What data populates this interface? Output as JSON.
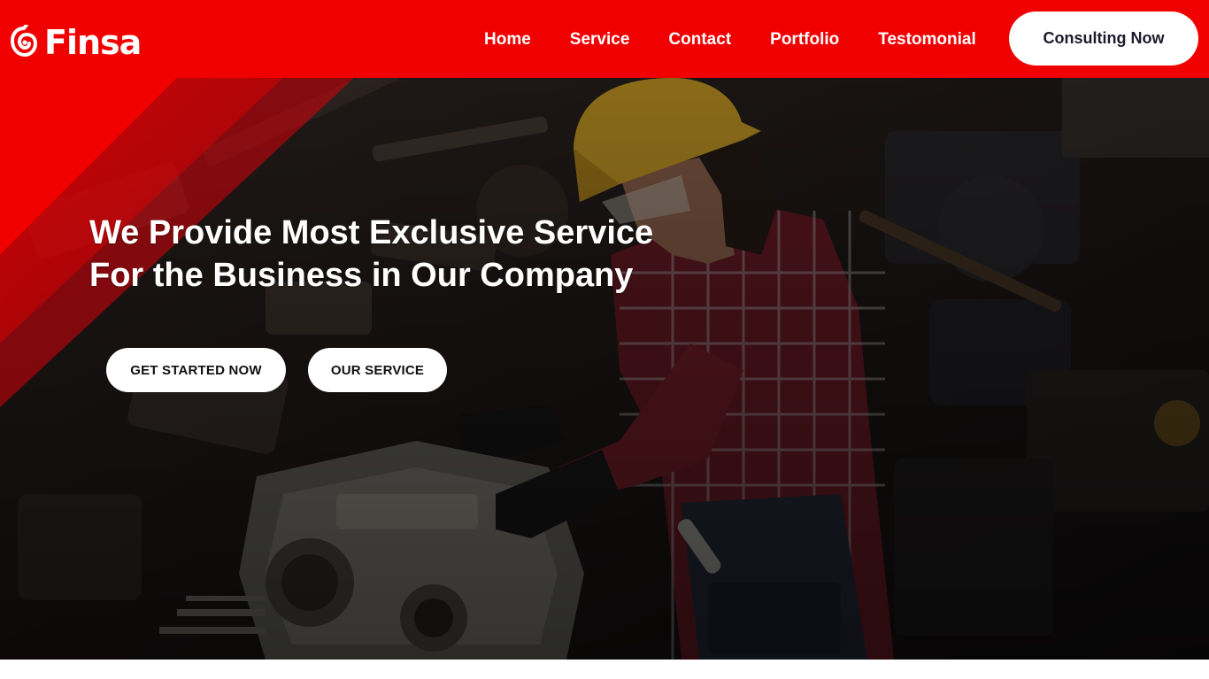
{
  "brand": {
    "name": "Finsa",
    "logo_icon": "spiral-logo-icon"
  },
  "nav": {
    "items": [
      {
        "label": "Home"
      },
      {
        "label": "Service"
      },
      {
        "label": "Contact"
      },
      {
        "label": "Portfolio"
      },
      {
        "label": "Testomonial"
      }
    ],
    "cta_label": "Consulting Now"
  },
  "hero": {
    "headline_line1": "We Provide Most Exclusive Service",
    "headline_line2": "For the Business in Our Company",
    "primary_button": "GET STARTED NOW",
    "secondary_button": "OUR SERVICE",
    "image": "worker-in-hard-hat-repairing-engine-photo"
  },
  "colors": {
    "brand_red": "#f00000",
    "white": "#ffffff",
    "button_text": "#1b1b2b"
  }
}
